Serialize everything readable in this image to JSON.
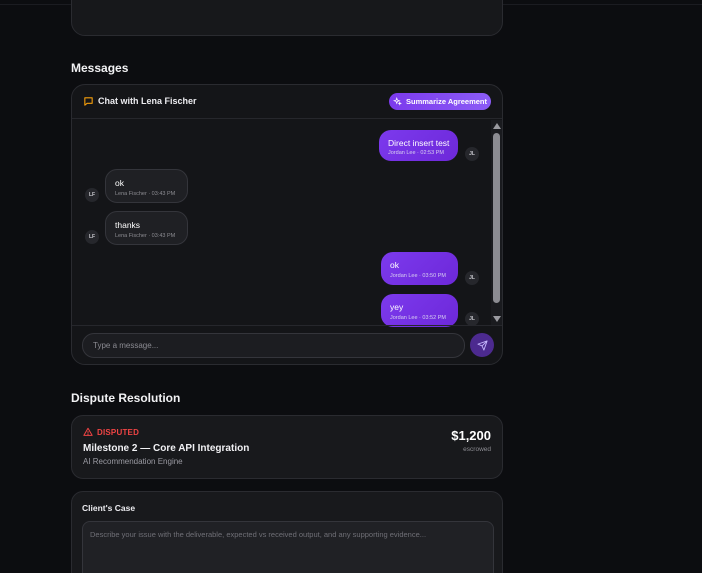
{
  "messages_section": {
    "title": "Messages",
    "chat_title": "Chat with Lena Fischer",
    "summarize_label": "Summarize Agreement",
    "input_placeholder": "Type a message...",
    "messages": [
      {
        "direction": "out",
        "text": "Direct insert test",
        "sender": "Jordan Lee",
        "time": "02:53 PM",
        "meta": "Jordan Lee · 02:53 PM",
        "initials": "JL"
      },
      {
        "direction": "in",
        "text": "ok",
        "sender": "Lena Fischer",
        "time": "03:43 PM",
        "meta": "Lena Fischer · 03:43 PM",
        "initials": "LF"
      },
      {
        "direction": "in",
        "text": "thanks",
        "sender": "Lena Fischer",
        "time": "03:43 PM",
        "meta": "Lena Fischer · 03:43 PM",
        "initials": "LF"
      },
      {
        "direction": "out",
        "text": "ok",
        "sender": "Jordan Lee",
        "time": "03:50 PM",
        "meta": "Jordan Lee · 03:50 PM",
        "initials": "JL"
      },
      {
        "direction": "out",
        "text": "yey",
        "sender": "Jordan Lee",
        "time": "03:52 PM",
        "meta": "Jordan Lee · 03:52 PM",
        "initials": "JL"
      }
    ]
  },
  "dispute_section": {
    "title": "Dispute Resolution",
    "status": "DISPUTED",
    "milestone": "Milestone 2 — Core API Integration",
    "project": "AI Recommendation Engine",
    "amount": "$1,200",
    "amount_status": "escrowed"
  },
  "client_case": {
    "title": "Client's Case",
    "placeholder": "Describe your issue with the deliverable, expected vs received output, and any supporting evidence..."
  },
  "colors": {
    "accent": "#7c3aed",
    "danger": "#ef4444",
    "background": "#0c0d10",
    "card": "#17181b"
  },
  "icons": {
    "chat": "chat-bubble-icon",
    "summarize": "sparkles-icon",
    "send": "send-icon",
    "warning": "warning-triangle-icon"
  }
}
